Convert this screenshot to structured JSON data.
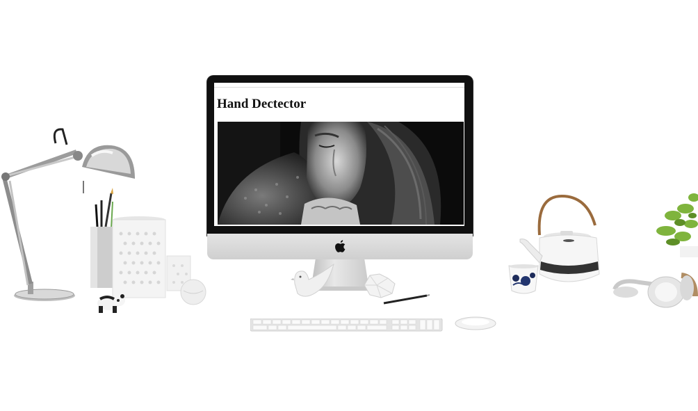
{
  "screen": {
    "page_title": "Hand Dectector"
  },
  "icons": {
    "brand": "apple-icon"
  }
}
